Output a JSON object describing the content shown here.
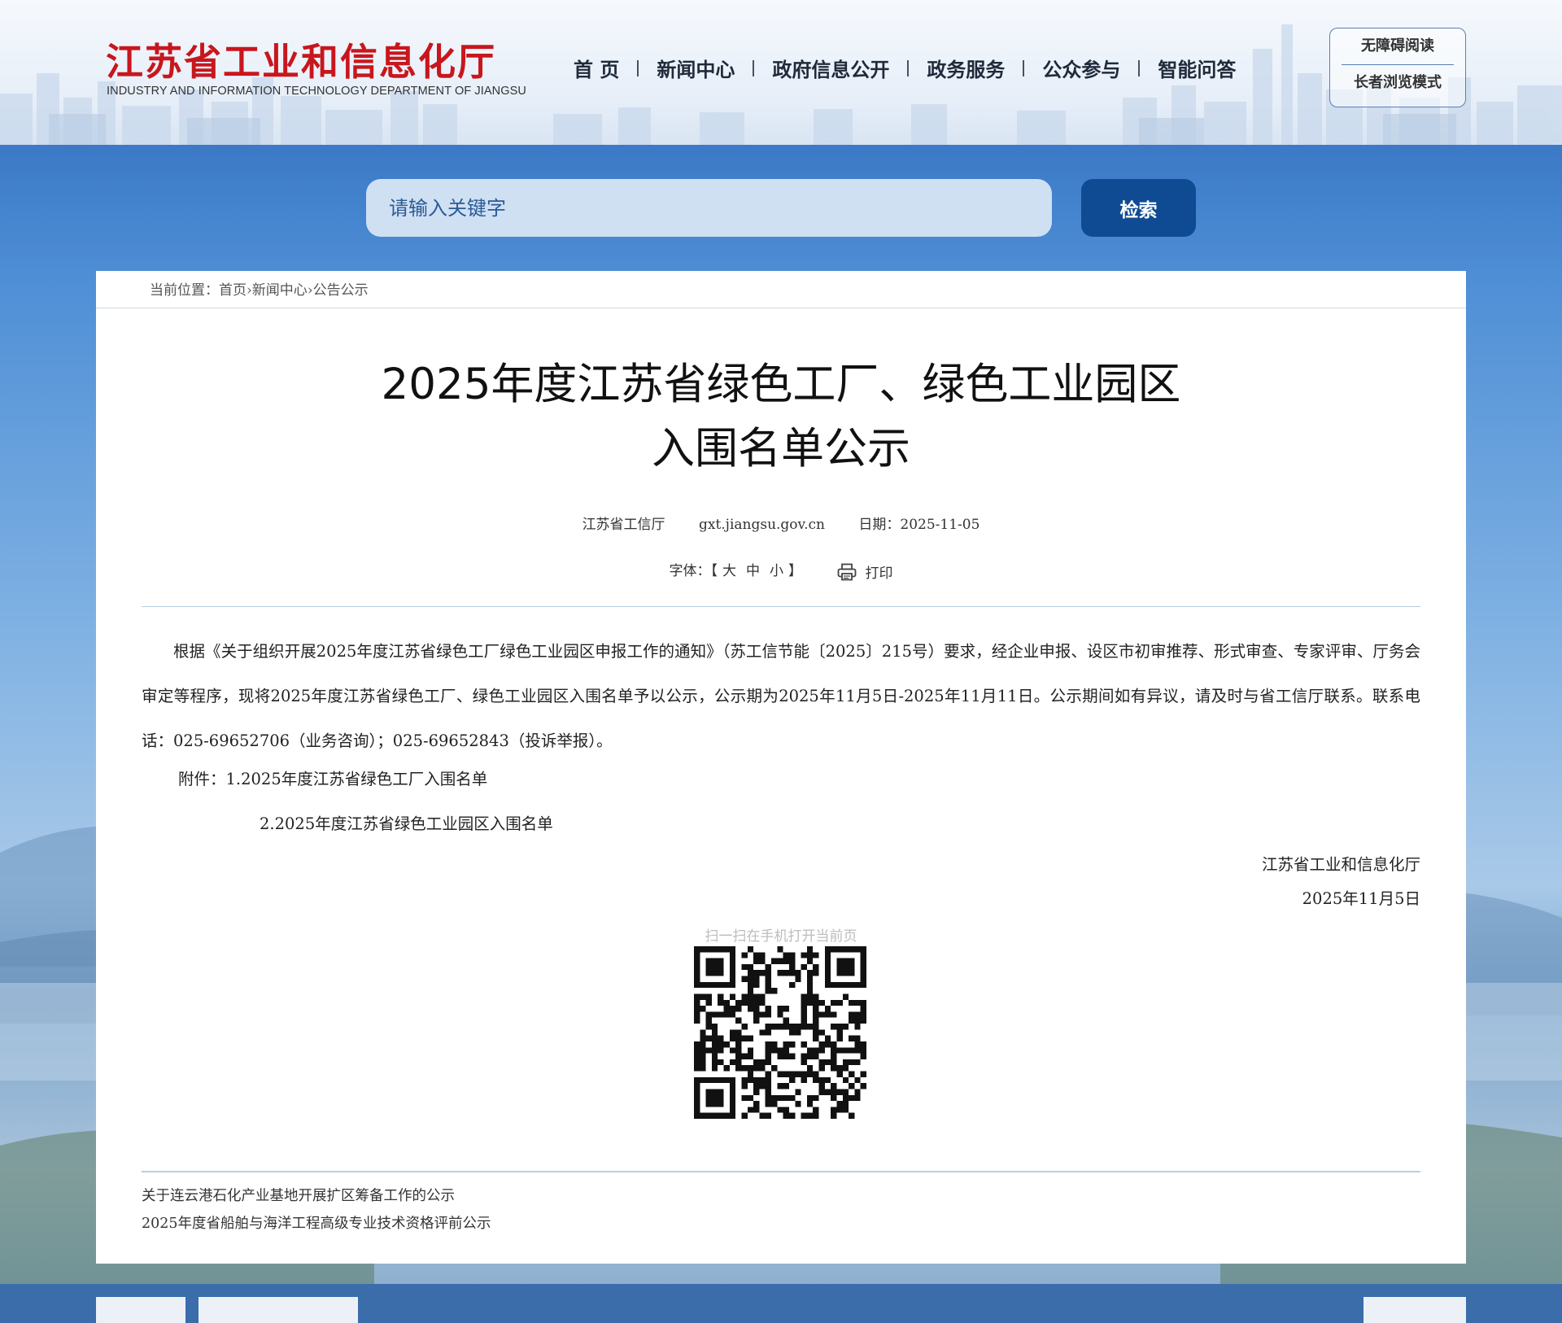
{
  "header": {
    "logo_cn": "江苏省工业和信息化厅",
    "logo_en": "INDUSTRY AND INFORMATION TECHNOLOGY DEPARTMENT OF JIANGSU",
    "nav": [
      "首 页",
      "新闻中心",
      "政府信息公开",
      "政务服务",
      "公众参与",
      "智能问答"
    ],
    "accessibility": {
      "read": "无障碍阅读",
      "elder": "长者浏览模式"
    }
  },
  "search": {
    "placeholder": "请输入关键字",
    "button": "检索"
  },
  "breadcrumb": {
    "prefix": "当前位置：",
    "items": [
      "首页",
      "新闻中心",
      "公告公示"
    ],
    "separator": "›"
  },
  "article": {
    "title_line1": "2025年度江苏省绿色工厂、绿色工业园区",
    "title_line2": "入围名单公示",
    "source": "江苏省工信厅",
    "site": "gxt.jiangsu.gov.cn",
    "date_label": "日期：",
    "date": "2025-11-05",
    "font_label": "字体：",
    "font_open": "【",
    "font_sizes": [
      "大",
      "中",
      "小"
    ],
    "font_close": "】",
    "print": "打印",
    "body": "根据《关于组织开展2025年度江苏省绿色工厂绿色工业园区申报工作的通知》（苏工信节能〔2025〕215号）要求，经企业申报、设区市初审推荐、形式审查、专家评审、厅务会审定等程序，现将2025年度江苏省绿色工厂、绿色工业园区入围名单予以公示，公示期为2025年11月5日-2025年11月11日。公示期间如有异议，请及时与省工信厅联系。联系电话：025-69652706（业务咨询）；025-69652843（投诉举报）。",
    "attachment_label": "附件：",
    "attachments": [
      "1.2025年度江苏省绿色工厂入围名单",
      "2.2025年度江苏省绿色工业园区入围名单"
    ],
    "signature": "江苏省工业和信息化厅",
    "sign_date": "2025年11月5日",
    "qr_label": "扫一扫在手机打开当前页"
  },
  "related": [
    "关于连云港石化产业基地开展扩区筹备工作的公示",
    "2025年度省船舶与海洋工程高级专业技术资格评前公示"
  ],
  "colors": {
    "accent": "#0f4b93",
    "logo": "#c8161d",
    "search_bg": "#cfe0f3"
  }
}
